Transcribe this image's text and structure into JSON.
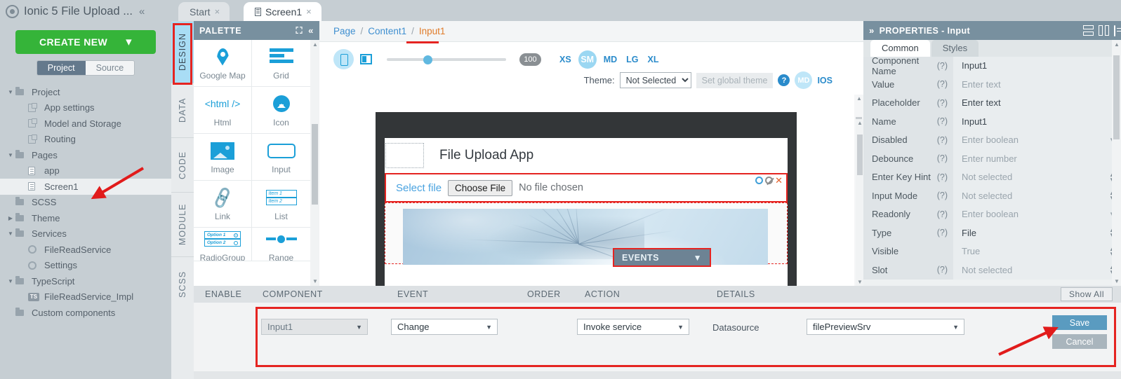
{
  "project": {
    "title": "Ionic 5 File Upload ...",
    "collapse_icon": "chevron-double-left-icon",
    "create_new_label": "CREATE NEW",
    "create_new_chevron": "chevron-down-icon",
    "segments": [
      {
        "label": "Project",
        "active": true
      },
      {
        "label": "Source",
        "active": false
      }
    ],
    "tree": [
      {
        "label": "Project",
        "icon": "folder-icon",
        "arrow": "down",
        "indent": 0
      },
      {
        "label": "App settings",
        "icon": "settings-file-icon",
        "arrow": "",
        "indent": 1
      },
      {
        "label": "Model and Storage",
        "icon": "settings-file-icon",
        "arrow": "",
        "indent": 1
      },
      {
        "label": "Routing",
        "icon": "settings-file-icon",
        "arrow": "",
        "indent": 1
      },
      {
        "label": "Pages",
        "icon": "folder-icon",
        "arrow": "down",
        "indent": 0
      },
      {
        "label": "app",
        "icon": "page-file-icon",
        "arrow": "",
        "indent": 1
      },
      {
        "label": "Screen1",
        "icon": "page-file-icon",
        "arrow": "",
        "indent": 1,
        "selected": true
      },
      {
        "label": "SCSS",
        "icon": "folder-icon",
        "arrow": "",
        "indent": 0
      },
      {
        "label": "Theme",
        "icon": "folder-icon",
        "arrow": "right",
        "indent": 0
      },
      {
        "label": "Services",
        "icon": "folder-icon",
        "arrow": "down",
        "indent": 0
      },
      {
        "label": "FileReadService",
        "icon": "gear-icon",
        "arrow": "",
        "indent": 1
      },
      {
        "label": "Settings",
        "icon": "gear-icon",
        "arrow": "",
        "indent": 1
      },
      {
        "label": "TypeScript",
        "icon": "folder-icon",
        "arrow": "down",
        "indent": 0
      },
      {
        "label": "FileReadService_Impl",
        "icon": "typescript-icon",
        "arrow": "",
        "indent": 1
      },
      {
        "label": "Custom components",
        "icon": "folder-icon",
        "arrow": "",
        "indent": 0
      }
    ]
  },
  "rail": {
    "tabs": [
      {
        "label": "DESIGN",
        "active": true
      },
      {
        "label": "DATA",
        "active": false
      },
      {
        "label": "CODE",
        "active": false
      },
      {
        "label": "MODULE",
        "active": false
      },
      {
        "label": "SCSS",
        "active": false
      }
    ]
  },
  "tabs": [
    {
      "label": "Start",
      "active": false,
      "close": "×"
    },
    {
      "label": "Screen1",
      "active": true,
      "close": "×"
    }
  ],
  "palette": {
    "title": "PALETTE",
    "expand_icon": "expand-icon",
    "collapse_icon": "chevron-double-left-icon",
    "items": [
      {
        "label": "Google Map",
        "icon": "map-pin-icon"
      },
      {
        "label": "Grid",
        "icon": "grid-icon"
      },
      {
        "label": "Html",
        "icon": "html-icon",
        "glyph": "<html />"
      },
      {
        "label": "Icon",
        "icon": "home-icon"
      },
      {
        "label": "Image",
        "icon": "image-icon"
      },
      {
        "label": "Input",
        "icon": "input-icon"
      },
      {
        "label": "Link",
        "icon": "link-icon",
        "glyph": "🔗"
      },
      {
        "label": "List",
        "icon": "list-icon",
        "row1": "Item 1",
        "row2": "Item 2"
      },
      {
        "label": "RadioGroup",
        "icon": "radiogroup-icon",
        "row1": "Option 1",
        "row2": "Option 2"
      },
      {
        "label": "Range",
        "icon": "range-icon"
      }
    ]
  },
  "breadcrumb": {
    "page": "Page",
    "content": "Content1",
    "current": "Input1",
    "sep": "/"
  },
  "devbar": {
    "phone_icon": "phone-icon",
    "tablet_icon": "tablet-icon",
    "zoom_value": "100",
    "breakpoints": [
      {
        "label": "XS",
        "active": false
      },
      {
        "label": "SM",
        "active": true
      },
      {
        "label": "MD",
        "active": false
      },
      {
        "label": "LG",
        "active": false
      },
      {
        "label": "XL",
        "active": false
      }
    ],
    "theme_label": "Theme:",
    "theme_value": "Not Selected",
    "set_global_theme": "Set global theme",
    "help_icon": "question-icon",
    "help_glyph": "?",
    "md_badge": "MD",
    "ios_label": "IOS"
  },
  "canvas": {
    "app_title": "File Upload App",
    "select_file_label": "Select file",
    "choose_file_button": "Choose File",
    "no_file_chosen": "No file chosen",
    "row_icons": [
      "gear-icon",
      "disable-icon",
      "close-icon"
    ],
    "events_button": "EVENTS",
    "events_chevron": "chevrons-down-icon"
  },
  "properties": {
    "title": "PROPERTIES - Input",
    "expand_icon": "chevron-double-right-icon",
    "header_icons": [
      "rows-layout-icon",
      "columns-layout-icon",
      "folder-layout-icon"
    ],
    "tabs": [
      {
        "label": "Common",
        "active": true
      },
      {
        "label": "Styles",
        "active": false
      }
    ],
    "rows": [
      {
        "key": "Component Name",
        "q": "(?)",
        "value": "Input1",
        "placeholder": false,
        "control": "text"
      },
      {
        "key": "Value",
        "q": "(?)",
        "value": "Enter text",
        "placeholder": true,
        "control": "text"
      },
      {
        "key": "Placeholder",
        "q": "(?)",
        "value": "Enter text",
        "placeholder": false,
        "control": "text"
      },
      {
        "key": "Name",
        "q": "(?)",
        "value": "Input1",
        "placeholder": false,
        "control": "text"
      },
      {
        "key": "Disabled",
        "q": "(?)",
        "value": "Enter boolean",
        "placeholder": true,
        "control": "caret"
      },
      {
        "key": "Debounce",
        "q": "(?)",
        "value": "Enter number",
        "placeholder": true,
        "control": "text"
      },
      {
        "key": "Enter Key Hint",
        "q": "(?)",
        "value": "Not selected",
        "placeholder": true,
        "control": "spin"
      },
      {
        "key": "Input Mode",
        "q": "(?)",
        "value": "Not selected",
        "placeholder": true,
        "control": "spin"
      },
      {
        "key": "Readonly",
        "q": "(?)",
        "value": "Enter boolean",
        "placeholder": true,
        "control": "caret"
      },
      {
        "key": "Type",
        "q": "(?)",
        "value": "File",
        "placeholder": false,
        "control": "spin"
      },
      {
        "key": "Visible",
        "q": "",
        "value": "True",
        "placeholder": true,
        "control": "spin"
      },
      {
        "key": "Slot",
        "q": "(?)",
        "value": "Not selected",
        "placeholder": true,
        "control": "spin"
      }
    ]
  },
  "events": {
    "columns": [
      "ENABLE",
      "COMPONENT",
      "EVENT",
      "ORDER",
      "ACTION",
      "DETAILS"
    ],
    "show_all": "Show All",
    "row": {
      "component": "Input1",
      "event": "Change",
      "order": "",
      "action": "Invoke service",
      "details_label": "Datasource",
      "datasource": "filePreviewSrv"
    },
    "save": "Save",
    "cancel": "Cancel"
  },
  "colors": {
    "accent_green": "#35b439",
    "accent_blue": "#1b9fd8",
    "panel_header": "#78909f",
    "highlight_red": "#e52421",
    "save_blue": "#5a9bc0"
  }
}
